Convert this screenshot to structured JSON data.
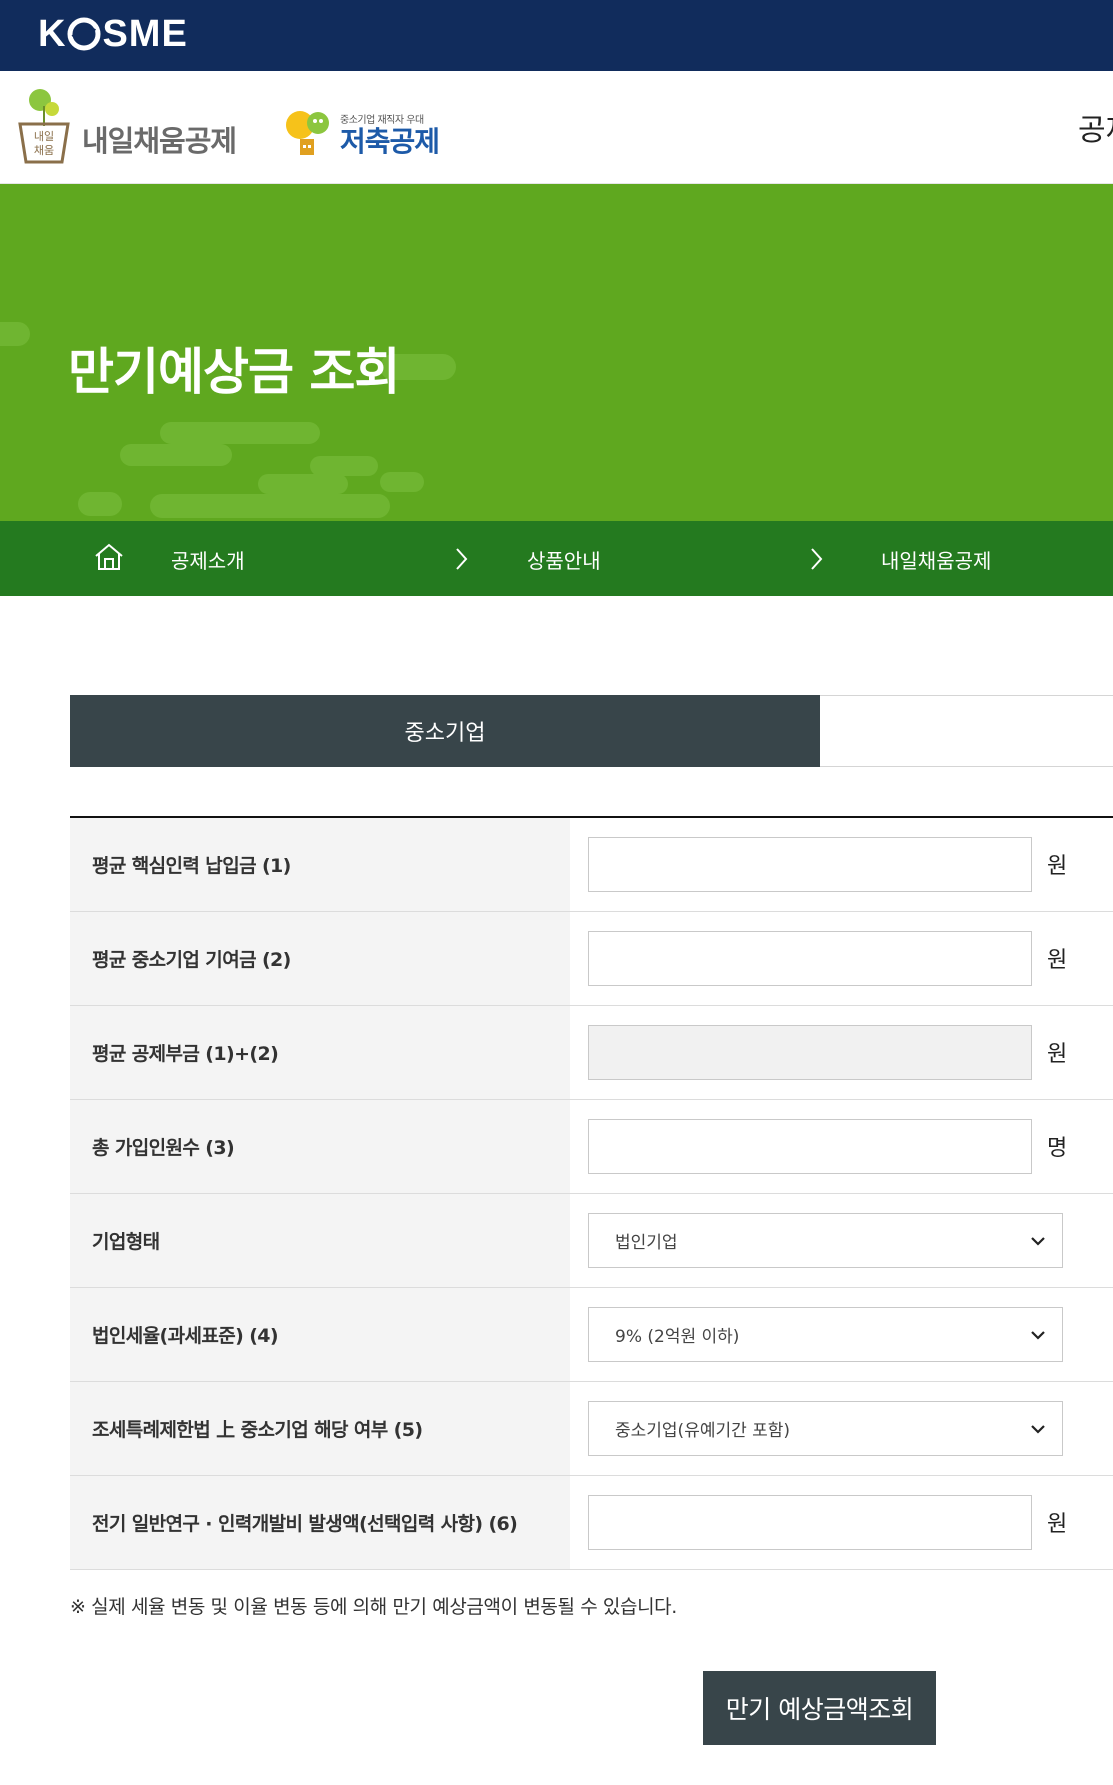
{
  "header": {
    "logo_text": "KOSME",
    "brand_primary": "내일채움공제",
    "brand_primary_icon_text": "내일채움",
    "brand_secondary_small": "중소기업 재직자 우대",
    "brand_secondary": "저축공제",
    "brand_right_partial": "공제"
  },
  "hero": {
    "title": "만기예상금 조회"
  },
  "breadcrumb": {
    "items": [
      "공제소개",
      "상품안내",
      "내일채움공제"
    ]
  },
  "tabs": {
    "active_label": "중소기업",
    "inactive_label": ""
  },
  "form": {
    "rows": [
      {
        "label": "평균 핵심인력 납입금 (1)",
        "value": "",
        "unit": "원"
      },
      {
        "label": "평균 중소기업 기여금 (2)",
        "value": "",
        "unit": "원"
      },
      {
        "label": "평균 공제부금 (1)+(2)",
        "value": "",
        "unit": "원"
      },
      {
        "label": "총 가입인원수 (3)",
        "value": "",
        "unit": "명"
      },
      {
        "label": "기업형태",
        "selected": "법인기업"
      },
      {
        "label": "법인세율(과세표준) (4)",
        "selected": "9% (2억원 이하)"
      },
      {
        "label": "조세특례제한법 上 중소기업 해당 여부 (5)",
        "selected": "중소기업(유예기간 포함)"
      },
      {
        "label": "전기 일반연구 · 인력개발비 발생액(선택입력 사항) (6)",
        "value": "",
        "unit": "원"
      }
    ]
  },
  "note": "※ 실제 세율 변동 및 이율 변동 등에 의해 만기 예상금액이 변동될 수 있습니다.",
  "submit_label": "만기 예상금액조회",
  "colors": {
    "topbar": "#112c5c",
    "hero_green": "#5fa81f",
    "breadcrumb_green": "#247a1f",
    "dark_slate": "#38454a"
  }
}
